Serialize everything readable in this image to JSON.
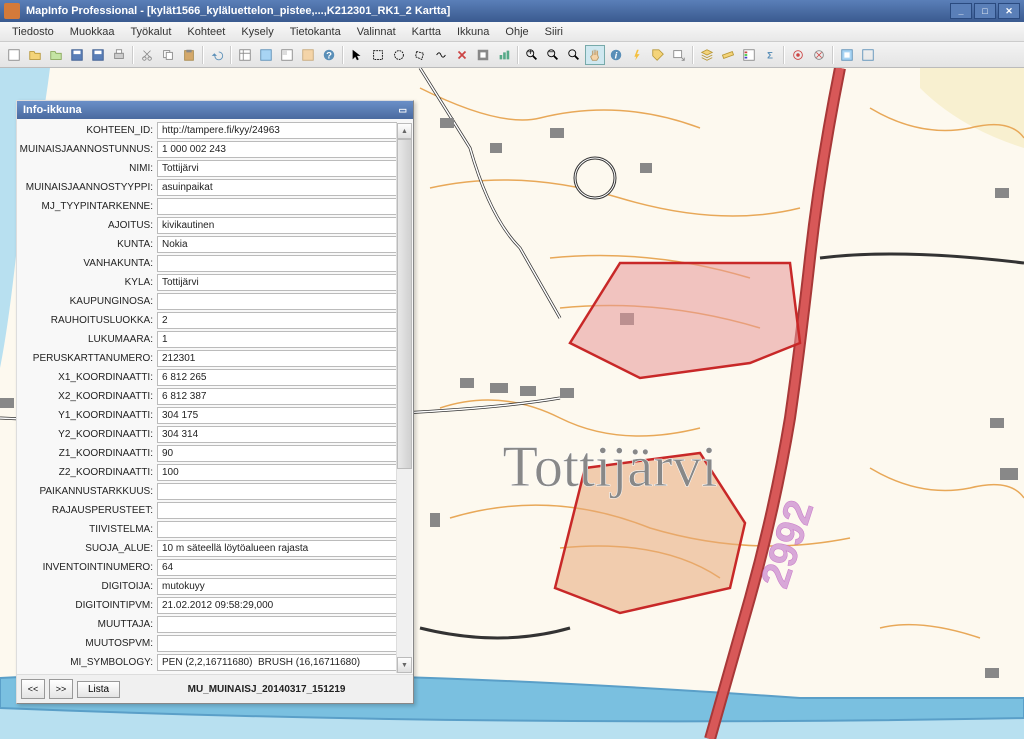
{
  "app_title": "MapInfo Professional - [kylät1566_kyläluettelon_pistee,...,K212301_RK1_2 Kartta]",
  "menu": [
    "Tiedosto",
    "Muokkaa",
    "Työkalut",
    "Kohteet",
    "Kysely",
    "Tietokanta",
    "Valinnat",
    "Kartta",
    "Ikkuna",
    "Ohje",
    "Siiri"
  ],
  "infowindow": {
    "title": "Info-ikkuna",
    "fields": [
      {
        "label": "KOHTEEN_ID:",
        "value": "http://tampere.fi/kyy/24963"
      },
      {
        "label": "MUINAISJAANNOSTUNNUS:",
        "value": "1 000 002 243"
      },
      {
        "label": "NIMI:",
        "value": "Tottijärvi"
      },
      {
        "label": "MUINAISJAANNOSTYYPPI:",
        "value": "asuinpaikat"
      },
      {
        "label": "MJ_TYYPINTARKENNE:",
        "value": ""
      },
      {
        "label": "AJOITUS:",
        "value": "kivikautinen"
      },
      {
        "label": "KUNTA:",
        "value": "Nokia"
      },
      {
        "label": "VANHAKUNTA:",
        "value": ""
      },
      {
        "label": "KYLA:",
        "value": "Tottijärvi"
      },
      {
        "label": "KAUPUNGINOSA:",
        "value": ""
      },
      {
        "label": "RAUHOITUSLUOKKA:",
        "value": "2"
      },
      {
        "label": "LUKUMAARA:",
        "value": "1"
      },
      {
        "label": "PERUSKARTTANUMERO:",
        "value": "212301"
      },
      {
        "label": "X1_KOORDINAATTI:",
        "value": "6 812 265"
      },
      {
        "label": "X2_KOORDINAATTI:",
        "value": "6 812 387"
      },
      {
        "label": "Y1_KOORDINAATTI:",
        "value": "304 175"
      },
      {
        "label": "Y2_KOORDINAATTI:",
        "value": "304 314"
      },
      {
        "label": "Z1_KOORDINAATTI:",
        "value": "90"
      },
      {
        "label": "Z2_KOORDINAATTI:",
        "value": "100"
      },
      {
        "label": "PAIKANNUSTARKKUUS:",
        "value": ""
      },
      {
        "label": "RAJAUSPERUSTEET:",
        "value": ""
      },
      {
        "label": "TIIVISTELMA:",
        "value": ""
      },
      {
        "label": "SUOJA_ALUE:",
        "value": "10 m säteellä löytöalueen rajasta"
      },
      {
        "label": "INVENTOINTINUMERO:",
        "value": "64"
      },
      {
        "label": "DIGITOIJA:",
        "value": "mutokuyy"
      },
      {
        "label": "DIGITOINTIPVM:",
        "value": "21.02.2012 09:58:29,000"
      },
      {
        "label": "MUUTTAJA:",
        "value": ""
      },
      {
        "label": "MUUTOSPVM:",
        "value": ""
      },
      {
        "label": "MI_SYMBOLOGY:",
        "value": "PEN (2,2,16711680)  BRUSH (16,16711680)"
      }
    ],
    "nav_prev": "<<",
    "nav_next": ">>",
    "list_btn": "Lista",
    "status": "MU_MUINAISJ_20140317_151219"
  },
  "map": {
    "place_label": "Tottijärvi",
    "road_number": "2992"
  }
}
